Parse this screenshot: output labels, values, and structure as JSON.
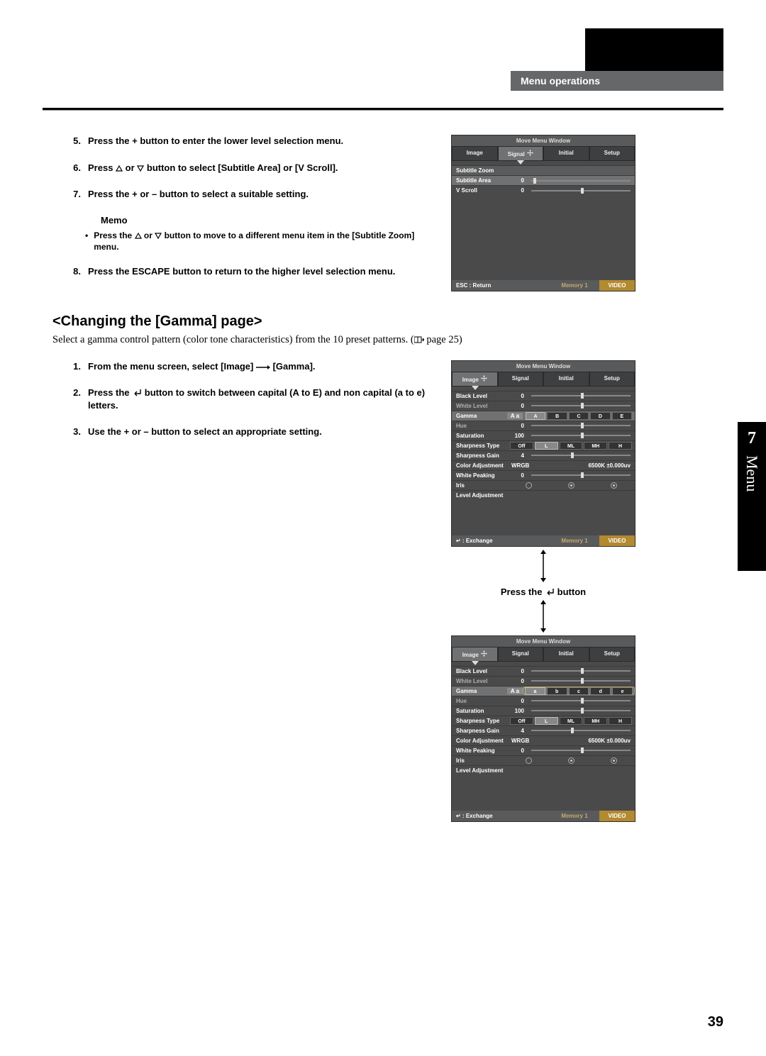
{
  "header": {
    "section": "Menu operations"
  },
  "side": {
    "num": "7",
    "label": "Menu"
  },
  "page_num": "39",
  "stepsA": {
    "s5": {
      "n": "5.",
      "t": "Press the + button to enter the lower level selection menu."
    },
    "s6": {
      "n": "6.",
      "t1": "Press ",
      "t2": " or ",
      "t3": " button to select [Subtitle Area] or [V Scroll]."
    },
    "s7": {
      "n": "7.",
      "t": "Press the + or – button to select a suitable setting."
    },
    "memo_hd": "Memo",
    "memo1": {
      "t1": "Press the ",
      "t2": " or ",
      "t3": " button to move to a different menu item in the [Subtitle Zoom] menu."
    },
    "s8": {
      "n": "8.",
      "t": "Press the ESCAPE button to return to the higher level selection menu."
    }
  },
  "sectB": {
    "h": "<Changing the [Gamma] page>",
    "intro1": "Select a gamma control pattern (color tone characteristics) from the 10 preset patterns. (",
    "intro2": " page 25)"
  },
  "stepsB": {
    "s1": {
      "n": "1.",
      "t1": "From the menu screen, select [Image] ",
      "t2": " [Gamma]."
    },
    "s2": {
      "n": "2.",
      "t1": "Press the ",
      "t2": " button to switch between capital (A to E) and non capital (a to e) letters."
    },
    "s3": {
      "n": "3.",
      "t": "Use the + or – button to select an appropriate setting."
    }
  },
  "press_enter": {
    "t1": "Press the ",
    "t2": " button"
  },
  "osd_common": {
    "title": "Move Menu Window",
    "tabs": {
      "image": "Image",
      "signal": "Signal",
      "initial": "Initial",
      "setup": "Setup"
    },
    "foot_mem": "Memory 1",
    "foot_vid": "VIDEO"
  },
  "osd1": {
    "rows": {
      "sz": {
        "l": "Subtitle Zoom"
      },
      "sa": {
        "l": "Subtitle Area",
        "v": "0"
      },
      "vs": {
        "l": "V Scroll",
        "v": "0"
      }
    },
    "foot_l": "ESC : Return"
  },
  "osd2": {
    "rows": {
      "bl": {
        "l": "Black Level",
        "v": "0"
      },
      "wl": {
        "l": "White Level",
        "v": "0"
      },
      "gm": {
        "l": "Gamma",
        "badge": "A a",
        "opts": [
          "A",
          "B",
          "C",
          "D",
          "E"
        ]
      },
      "hu": {
        "l": "Hue",
        "v": "0"
      },
      "sa": {
        "l": "Saturation",
        "v": "100"
      },
      "st": {
        "l": "Sharpness Type",
        "opts": [
          "Off",
          "L",
          "ML",
          "MH",
          "H"
        ]
      },
      "sg": {
        "l": "Sharpness Gain",
        "v": "4"
      },
      "ca": {
        "l": "Color Adjustment",
        "v1": "WRGB",
        "v2": "6500K ±0.000uv"
      },
      "wp": {
        "l": "White Peaking",
        "v": "0"
      },
      "ir": {
        "l": "Iris"
      },
      "la": {
        "l": "Level Adjustment"
      }
    },
    "foot_l": "↵ : Exchange"
  },
  "osd3": {
    "rows": {
      "bl": {
        "l": "Black Level",
        "v": "0"
      },
      "wl": {
        "l": "White Level",
        "v": "0"
      },
      "gm": {
        "l": "Gamma",
        "badge": "A a",
        "opts": [
          "a",
          "b",
          "c",
          "d",
          "e"
        ]
      },
      "hu": {
        "l": "Hue",
        "v": "0"
      },
      "sa": {
        "l": "Saturation",
        "v": "100"
      },
      "st": {
        "l": "Sharpness Type",
        "opts": [
          "Off",
          "L",
          "ML",
          "MH",
          "H"
        ]
      },
      "sg": {
        "l": "Sharpness Gain",
        "v": "4"
      },
      "ca": {
        "l": "Color Adjustment",
        "v1": "WRGB",
        "v2": "6500K ±0.000uv"
      },
      "wp": {
        "l": "White Peaking",
        "v": "0"
      },
      "ir": {
        "l": "Iris"
      },
      "la": {
        "l": "Level Adjustment"
      }
    },
    "foot_l": "↵ : Exchange"
  }
}
